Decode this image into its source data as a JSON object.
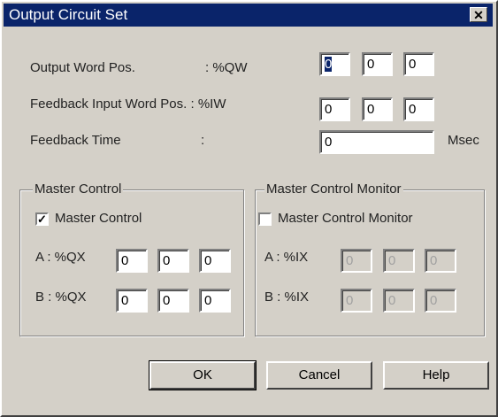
{
  "window": {
    "title": "Output Circuit Set",
    "close_glyph": "✕"
  },
  "output_word": {
    "label": "Output Word Pos.",
    "prefix": ": %QW",
    "values": [
      "0",
      "0",
      "0"
    ]
  },
  "feedback_input": {
    "label": "Feedback Input Word Pos. : %IW",
    "values": [
      "0",
      "0",
      "0"
    ]
  },
  "feedback_time": {
    "label": "Feedback Time",
    "colon": ":",
    "value": "0",
    "unit": "Msec"
  },
  "master_control": {
    "group_label": "Master Control",
    "checkbox_label": "Master Control",
    "checked": true,
    "check_glyph": "✓",
    "a_label": "A : %QX",
    "a_values": [
      "0",
      "0",
      "0"
    ],
    "b_label": "B : %QX",
    "b_values": [
      "0",
      "0",
      "0"
    ]
  },
  "master_monitor": {
    "group_label": "Master Control Monitor",
    "checkbox_label": "Master Control Monitor",
    "checked": false,
    "a_label": "A : %IX",
    "a_values": [
      "0",
      "0",
      "0"
    ],
    "b_label": "B : %IX",
    "b_values": [
      "0",
      "0",
      "0"
    ]
  },
  "buttons": {
    "ok": "OK",
    "cancel": "Cancel",
    "help": "Help"
  }
}
